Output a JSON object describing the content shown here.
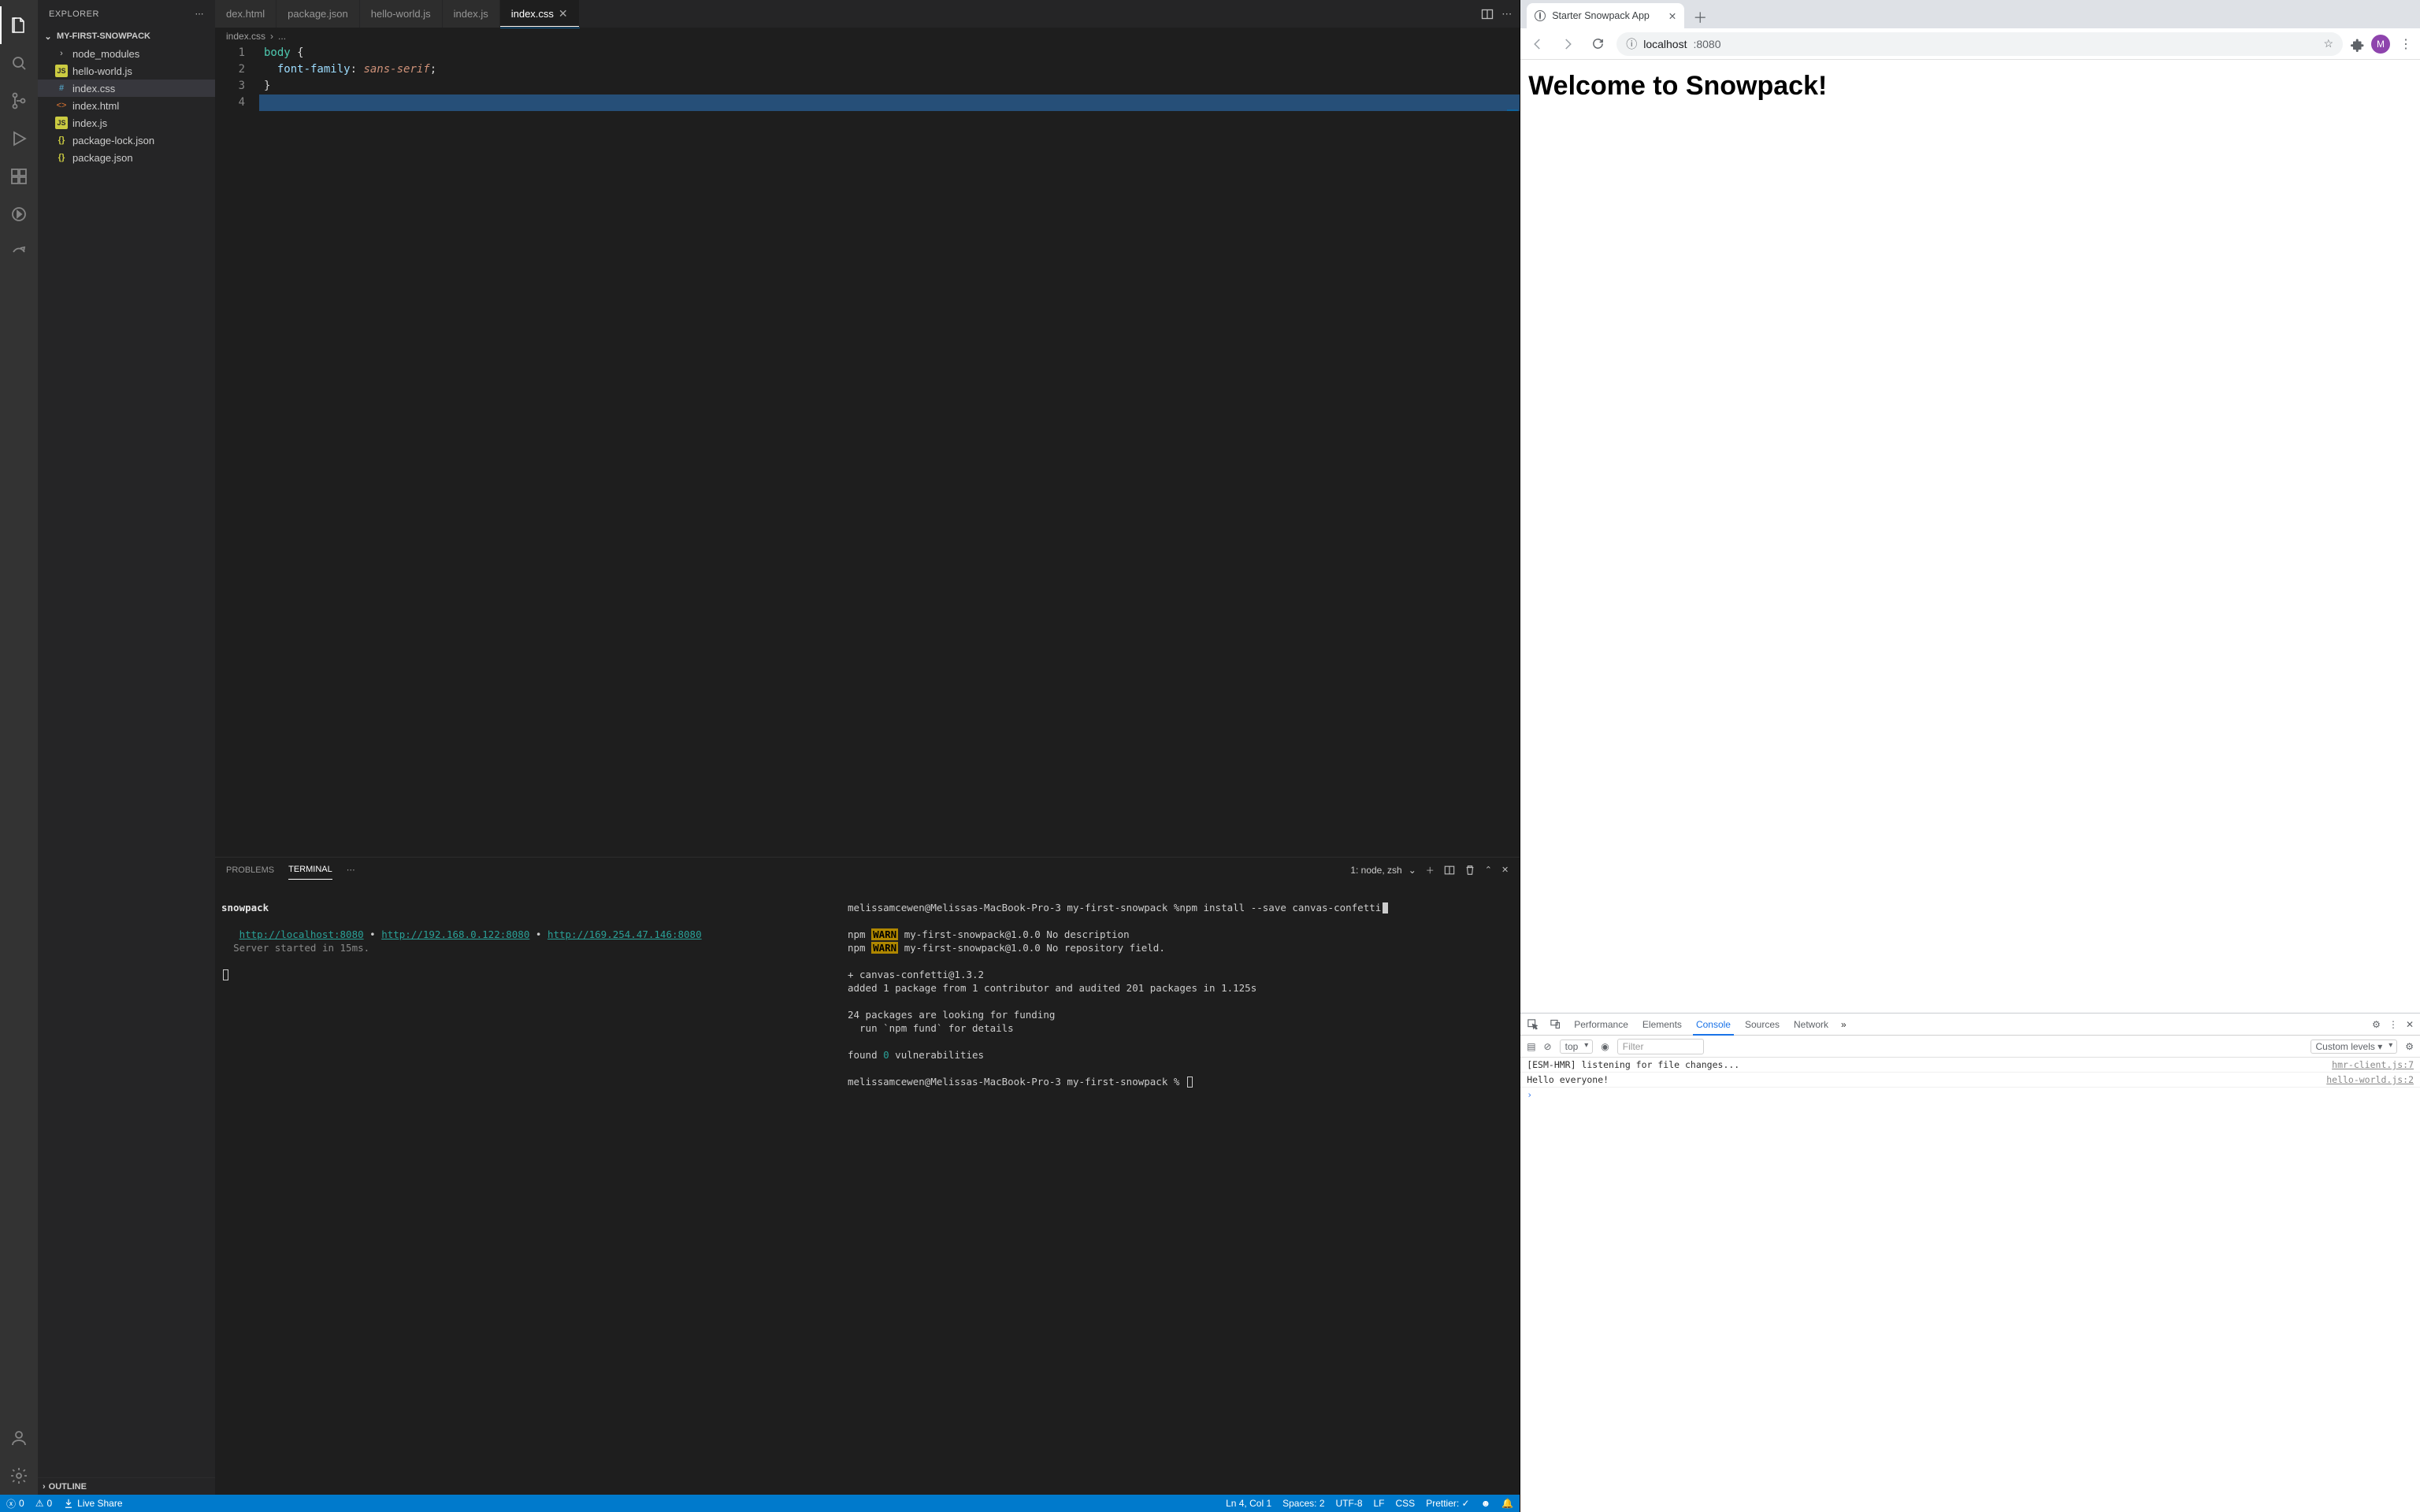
{
  "vscode": {
    "explorer_label": "EXPLORER",
    "project_name": "MY-FIRST-SNOWPACK",
    "outline_label": "OUTLINE",
    "tree": [
      {
        "kind": "folder",
        "label": "node_modules"
      },
      {
        "kind": "js",
        "label": "hello-world.js"
      },
      {
        "kind": "hash",
        "label": "index.css",
        "selected": true
      },
      {
        "kind": "code",
        "label": "index.html"
      },
      {
        "kind": "js",
        "label": "index.js"
      },
      {
        "kind": "json",
        "label": "package-lock.json"
      },
      {
        "kind": "json",
        "label": "package.json"
      }
    ],
    "tabs": [
      {
        "label": "dex.html"
      },
      {
        "label": "package.json"
      },
      {
        "label": "hello-world.js"
      },
      {
        "label": "index.js"
      },
      {
        "label": "index.css",
        "active": true
      }
    ],
    "breadcrumb": {
      "file": "index.css",
      "rest": "..."
    },
    "code": {
      "lines": [
        {
          "n": "1",
          "segs": [
            {
              "cls": "tok-sel",
              "t": "body"
            },
            {
              "cls": "tok-punc",
              "t": " {"
            }
          ]
        },
        {
          "n": "2",
          "segs": [
            {
              "cls": "tok-punc",
              "t": "  "
            },
            {
              "cls": "tok-prop",
              "t": "font-family"
            },
            {
              "cls": "tok-punc",
              "t": ": "
            },
            {
              "cls": "tok-val",
              "t": "sans-serif"
            },
            {
              "cls": "tok-punc",
              "t": ";"
            }
          ]
        },
        {
          "n": "3",
          "segs": [
            {
              "cls": "tok-punc",
              "t": "}"
            }
          ]
        },
        {
          "n": "4",
          "segs": [],
          "hl": true
        }
      ]
    },
    "panel": {
      "problems_label": "PROBLEMS",
      "terminal_label": "TERMINAL",
      "selector": "1: node, zsh",
      "left": {
        "title": "snowpack",
        "line1_pre": "   ",
        "link1": "http://localhost:8080",
        "sep": " • ",
        "link2": "http://192.168.0.122:8080",
        "link3": "http://169.254.47.146:8080",
        "started": "  Server started in 15ms."
      },
      "right": {
        "l1": "melissamcewen@Melissas-MacBook-Pro-3 my-first-snowpack %npm install --save canvas-confetti",
        "w1_pre": "npm ",
        "w1": "WARN",
        "w1_post": " my-first-snowpack@1.0.0 No description",
        "w2_pre": "npm ",
        "w2": "WARN",
        "w2_post": " my-first-snowpack@1.0.0 No repository field.",
        "l4": "+ canvas-confetti@1.3.2",
        "l5": "added 1 package from 1 contributor and audited 201 packages in 1.125s",
        "l6": "24 packages are looking for funding",
        "l7": "  run `npm fund` for details",
        "l8_a": "found ",
        "l8_b": "0",
        "l8_c": " vulnerabilities",
        "l9": "melissamcewen@Melissas-MacBook-Pro-3 my-first-snowpack % "
      }
    },
    "statusbar": {
      "errors": "0",
      "warnings": "0",
      "liveshare": "Live Share",
      "ln": "Ln 4, Col 1",
      "spaces": "Spaces: 2",
      "enc": "UTF-8",
      "eol": "LF",
      "lang": "CSS",
      "prettier": "Prettier: ✓"
    }
  },
  "chrome": {
    "tab_title": "Starter Snowpack App",
    "url_host": "localhost",
    "url_port": ":8080",
    "page_h1": "Welcome to Snowpack!",
    "avatar_letter": "M",
    "devtools": {
      "tabs": [
        "Performance",
        "Elements",
        "Console",
        "Sources",
        "Network"
      ],
      "active": "Console",
      "context": "top",
      "filter_placeholder": "Filter",
      "levels": "Custom levels ▾",
      "rows": [
        {
          "msg": "[ESM-HMR] listening for file changes...",
          "src": "hmr-client.js:7"
        },
        {
          "msg": "Hello everyone!",
          "src": "hello-world.js:2"
        }
      ]
    }
  }
}
